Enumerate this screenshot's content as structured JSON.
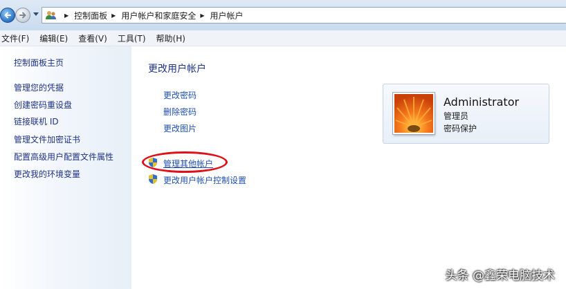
{
  "breadcrumb": [
    "控制面板",
    "用户帐户和家庭安全",
    "用户帐户"
  ],
  "menu": [
    "文件(F)",
    "编辑(E)",
    "查看(V)",
    "工具(T)",
    "帮助(H)"
  ],
  "sidebar": {
    "home": "控制面板主页",
    "items": [
      "管理您的凭据",
      "创建密码重设盘",
      "链接联机 ID",
      "管理文件加密证书",
      "配置高级用户配置文件属性",
      "更改我的环境变量"
    ]
  },
  "main": {
    "title": "更改用户帐户",
    "tasks": [
      "更改密码",
      "删除密码",
      "更改图片"
    ],
    "admin_links": [
      "管理其他帐户",
      "更改用户帐户控制设置"
    ]
  },
  "account": {
    "name": "Administrator",
    "role": "管理员",
    "status": "密码保护"
  },
  "watermark": "头条 @鑫荣电脑技术",
  "icons": {
    "back": "back-arrow-icon",
    "forward": "forward-arrow-icon",
    "users": "users-icon",
    "shield": "uac-shield-icon"
  },
  "colors": {
    "link": "#1f4fb3",
    "heading": "#1e3287",
    "highlight": "#e0101a"
  }
}
